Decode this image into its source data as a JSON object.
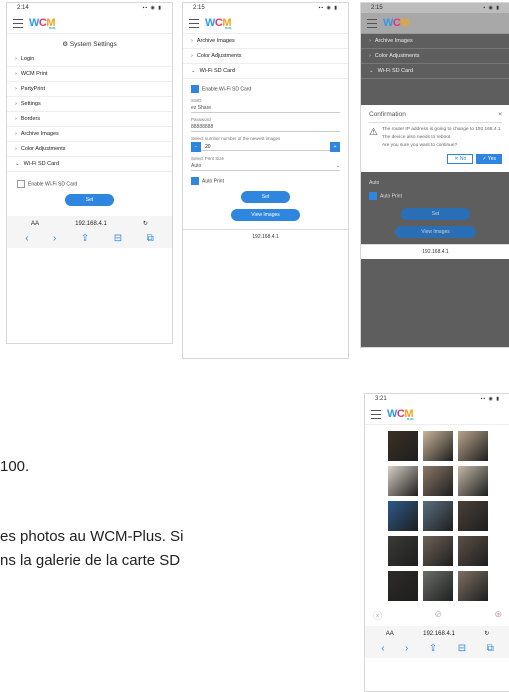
{
  "phone1": {
    "time": "2:14",
    "status_icons": "▪▪ ◉ ▮",
    "logo": {
      "w": "W",
      "c": "C",
      "m": "M",
      "plus": "PLUS"
    },
    "section_title": "System Settings",
    "menu": [
      "Login",
      "WCM Print",
      "PartyPrint",
      "Settings",
      "Borders",
      "Archive Images",
      "Color Adjustments"
    ],
    "wifi_section": "Wi-Fi SD Card",
    "enable_label": "Enable Wi-Fi SD Card",
    "set_button": "Set",
    "url_prefix": "AA",
    "url": "192.168.4.1",
    "reload": "↻",
    "nav": [
      "‹",
      "›",
      "⇪",
      "⊟",
      "⧉"
    ]
  },
  "phone2": {
    "time": "2:15",
    "status_icons": "▪▪ ◉ ▮",
    "menu": [
      "Archive Images",
      "Color Adjustments"
    ],
    "wifi_section": "Wi-Fi SD Card",
    "enable_label": "Enable Wi-Fi SD Card",
    "ssid_label": "SSID",
    "ssid_value": "ez Share",
    "password_label": "Password",
    "password_value": "88888888",
    "images_label": "Select number number of the newest images",
    "images_value": "20",
    "size_label": "Select Print Size",
    "size_value": "Auto",
    "autoprint_label": "Auto Print",
    "set_button": "Set",
    "view_button": "View Images",
    "url": "192.168.4.1"
  },
  "phone3": {
    "time": "2:15",
    "status_icons": "▪ ◉ ▮",
    "menu": [
      "Archive Images",
      "Color Adjustments",
      "Wi-Fi SD Card"
    ],
    "dialog_title": "Confirmation",
    "dialog_line1": "The router IP address is going to change to 192.168.4.1",
    "dialog_line2": "The device also needs to reboot.",
    "dialog_line3": "Are you sure you want to continue?",
    "no_button": "No",
    "yes_button": "Yes",
    "size_value": "Auto",
    "autoprint_label": "Auto Print",
    "set_button": "Set",
    "view_button": "View Images",
    "url": "192.168.4.1"
  },
  "phone4": {
    "time": "3:21",
    "status_icons": "▪▪ ◉ ▮",
    "url_prefix": "AA",
    "url": "192.168.4.1",
    "reload": "↻",
    "nav": [
      "‹",
      "›",
      "⇪",
      "⊟",
      "⧉"
    ],
    "photo_colors": [
      "#3b3026",
      "#c9b59a",
      "#b8a48a",
      "#d8d0c5",
      "#8a7868",
      "#c2b8a6",
      "#2d5a8a",
      "#5a6f80",
      "#4a4038",
      "#3a3a36",
      "#6e6258",
      "#5c5048",
      "#2e2a28",
      "#6a6e6a",
      "#7d6f62"
    ]
  },
  "text": {
    "line1": "100.",
    "line2": "es photos au WCM-Plus. Si",
    "line3": "ns la galerie de la carte SD"
  }
}
